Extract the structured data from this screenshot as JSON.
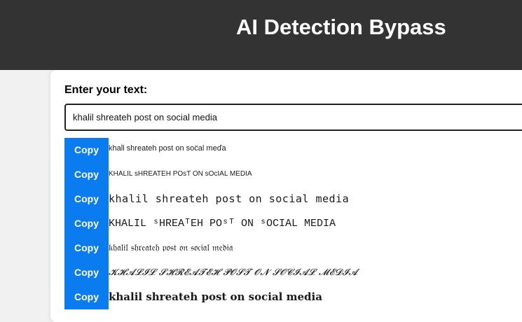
{
  "header": {
    "title": "AI Detection Bypass"
  },
  "form": {
    "label": "Enter your text:",
    "input_value": "khalil shreateh post on social media"
  },
  "colors": {
    "header_bg": "#333333",
    "copy_button": "#0b7cf0"
  },
  "results": [
    {
      "button": "Copy",
      "text": "khal̇l shreateh post on soc̈al meďa"
    },
    {
      "button": "Copy",
      "text": "KHALIL sHREATEH POsT ON sOcIAL MEDIA"
    },
    {
      "button": "Copy",
      "text": "khalil shreateh post on social media"
    },
    {
      "button": "Copy",
      "text": "KHALIL ˢHREAᵀEH POˢᵀ ON ˢOCIAL MEDIA"
    },
    {
      "button": "Copy",
      "text": "𝔨𝔥𝔞𝔩𝔦𝔩 𝔰𝔥𝔯𝔢𝔞𝔱𝔢𝔥 𝔭𝔬𝔰𝔱 𝔬𝔫 𝔰𝔬𝔠𝔦𝔞𝔩 𝔪𝔢𝔡𝔦𝔞"
    },
    {
      "button": "Copy",
      "text": "𝓚𝓗𝓐𝓛𝓘𝓛 𝓢𝓗𝓡𝓔𝓐𝓣𝓔𝓗 𝓟𝓞𝓢𝓣 𝓞𝓝 𝓢𝓞𝓒𝓘𝓐𝓛 𝓜𝓔𝓓𝓘𝓐"
    },
    {
      "button": "Copy",
      "text": "𝐤𝐡𝐚𝐥𝐢𝐥 𝐬𝐡𝐫𝐞𝐚𝐭𝐞𝐡 𝐩𝐨𝐬𝐭 𝐨𝐧 𝐬𝐨𝐜𝐢𝐚𝐥 𝐦𝐞𝐝𝐢𝐚"
    }
  ]
}
